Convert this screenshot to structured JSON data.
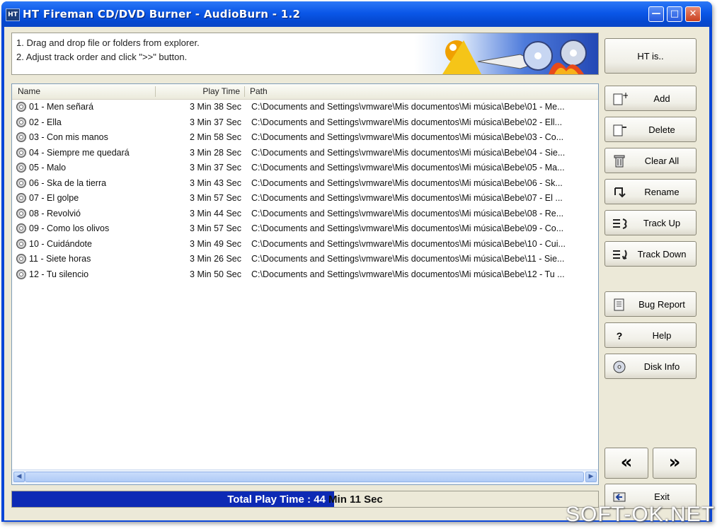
{
  "window": {
    "title": "HT Fireman CD/DVD Burner - AudioBurn - 1.2",
    "app_icon_label": "HT"
  },
  "instructions": {
    "line1": "1. Drag and drop file or folders from explorer.",
    "line2": "2. Adjust track order and click \">>\" button."
  },
  "side_buttons": {
    "ht": "HT is..",
    "add": "Add",
    "delete": "Delete",
    "clear_all": "Clear All",
    "rename": "Rename",
    "track_up": "Track Up",
    "track_down": "Track Down",
    "bug_report": "Bug Report",
    "help": "Help",
    "disk_info": "Disk Info",
    "exit": "Exit"
  },
  "nav": {
    "back": "«",
    "next": "»"
  },
  "list": {
    "columns": [
      "Name",
      "Play Time",
      "Path"
    ],
    "rows": [
      {
        "name": "01 - Men señará",
        "time": "3 Min 38 Sec",
        "path": "C:\\Documents and Settings\\vmware\\Mis documentos\\Mi música\\Bebe\\01 - Me..."
      },
      {
        "name": "02 - Ella",
        "time": "3 Min 37 Sec",
        "path": "C:\\Documents and Settings\\vmware\\Mis documentos\\Mi música\\Bebe\\02 - Ell..."
      },
      {
        "name": "03 - Con mis manos",
        "time": "2 Min 58 Sec",
        "path": "C:\\Documents and Settings\\vmware\\Mis documentos\\Mi música\\Bebe\\03 - Co..."
      },
      {
        "name": "04 - Siempre me quedará",
        "time": "3 Min 28 Sec",
        "path": "C:\\Documents and Settings\\vmware\\Mis documentos\\Mi música\\Bebe\\04 - Sie..."
      },
      {
        "name": "05 - Malo",
        "time": "3 Min 37 Sec",
        "path": "C:\\Documents and Settings\\vmware\\Mis documentos\\Mi música\\Bebe\\05 - Ma..."
      },
      {
        "name": "06 - Ska de la tierra",
        "time": "3 Min 43 Sec",
        "path": "C:\\Documents and Settings\\vmware\\Mis documentos\\Mi música\\Bebe\\06 - Sk..."
      },
      {
        "name": "07 - El golpe",
        "time": "3 Min 57 Sec",
        "path": "C:\\Documents and Settings\\vmware\\Mis documentos\\Mi música\\Bebe\\07 - El ..."
      },
      {
        "name": "08 - Revolvió",
        "time": "3 Min 44 Sec",
        "path": "C:\\Documents and Settings\\vmware\\Mis documentos\\Mi música\\Bebe\\08 - Re..."
      },
      {
        "name": "09 - Como los olivos",
        "time": "3 Min 57 Sec",
        "path": "C:\\Documents and Settings\\vmware\\Mis documentos\\Mi música\\Bebe\\09 - Co..."
      },
      {
        "name": "10 - Cuidándote",
        "time": "3 Min 49 Sec",
        "path": "C:\\Documents and Settings\\vmware\\Mis documentos\\Mi música\\Bebe\\10 - Cui..."
      },
      {
        "name": "11 - Siete horas",
        "time": "3 Min 26 Sec",
        "path": "C:\\Documents and Settings\\vmware\\Mis documentos\\Mi música\\Bebe\\11 - Sie..."
      },
      {
        "name": "12 - Tu silencio",
        "time": "3 Min 50 Sec",
        "path": "C:\\Documents and Settings\\vmware\\Mis documentos\\Mi música\\Bebe\\12 - Tu ..."
      }
    ]
  },
  "total": {
    "label": "Total Play Time : 44",
    "label_rest": " Min 11 Sec",
    "progress_fraction": 0.55
  },
  "watermark": "SOFT-OK.NET",
  "colors": {
    "titlebar": "#0a57e8",
    "progress": "#0d2ab5"
  }
}
